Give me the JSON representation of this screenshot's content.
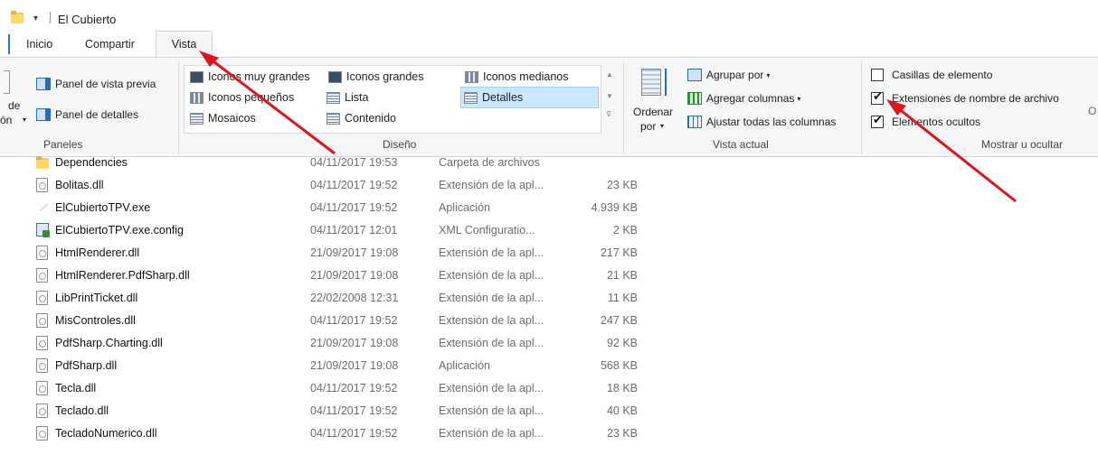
{
  "window": {
    "title": "El Cubierto",
    "quick_access_arrow": "▾"
  },
  "tabs": [
    {
      "label": "Inicio"
    },
    {
      "label": "Compartir"
    },
    {
      "label": "Vista"
    }
  ],
  "ribbon": {
    "panes": {
      "cut_label_1": "de",
      "cut_label_2": "ón",
      "preview_pane": "Panel de vista previa",
      "details_pane": "Panel de detalles",
      "group_label": "Paneles"
    },
    "layout": {
      "items": [
        "Iconos muy grandes",
        "Iconos grandes",
        "Iconos medianos",
        "Iconos pequeños",
        "Lista",
        "Detalles",
        "Mosaicos",
        "Contenido"
      ],
      "selected": "Detalles",
      "group_label": "Diseño"
    },
    "current_view": {
      "sort_by_1": "Ordenar",
      "sort_by_2": "por",
      "group_by": "Agrupar por",
      "add_columns": "Agregar columnas",
      "fit_columns": "Ajustar todas las columnas",
      "group_label": "Vista actual"
    },
    "show_hide": {
      "item_checkboxes": {
        "label": "Casillas de elemento",
        "checked": false
      },
      "file_extensions": {
        "label": "Extensiones de nombre de archivo",
        "checked": true
      },
      "hidden_items": {
        "label": "Elementos ocultos",
        "checked": true
      },
      "cut_label": "O",
      "group_label": "Mostrar u ocultar"
    }
  },
  "files": [
    {
      "name": "Dependencies",
      "date": "04/11/2017 19:53",
      "type": "Carpeta de archivos",
      "size": "",
      "icon": "folder-icon"
    },
    {
      "name": "Bolitas.dll",
      "date": "04/11/2017 19:52",
      "type": "Extensión de la apl...",
      "size": "23 KB",
      "icon": "dll-file-icon"
    },
    {
      "name": "ElCubiertoTPV.exe",
      "date": "04/11/2017 19:52",
      "type": "Aplicación",
      "size": "4.939 KB",
      "icon": "exe-file-icon"
    },
    {
      "name": "ElCubiertoTPV.exe.config",
      "date": "04/11/2017 12:01",
      "type": "XML Configuratio...",
      "size": "2 KB",
      "icon": "config-file-icon"
    },
    {
      "name": "HtmlRenderer.dll",
      "date": "21/09/2017 19:08",
      "type": "Extensión de la apl...",
      "size": "217 KB",
      "icon": "dll-file-icon"
    },
    {
      "name": "HtmlRenderer.PdfSharp.dll",
      "date": "21/09/2017 19:08",
      "type": "Extensión de la apl...",
      "size": "21 KB",
      "icon": "dll-file-icon"
    },
    {
      "name": "LibPrintTicket.dll",
      "date": "22/02/2008 12:31",
      "type": "Extensión de la apl...",
      "size": "11 KB",
      "icon": "dll-file-icon"
    },
    {
      "name": "MisControles.dll",
      "date": "04/11/2017 19:52",
      "type": "Extensión de la apl...",
      "size": "247 KB",
      "icon": "dll-file-icon"
    },
    {
      "name": "PdfSharp.Charting.dll",
      "date": "21/09/2017 19:08",
      "type": "Extensión de la apl...",
      "size": "92 KB",
      "icon": "dll-file-icon"
    },
    {
      "name": "PdfSharp.dll",
      "date": "21/09/2017 19:08",
      "type": "Aplicación",
      "size": "568 KB",
      "icon": "dll-file-icon"
    },
    {
      "name": "Tecla.dll",
      "date": "04/11/2017 19:52",
      "type": "Extensión de la apl...",
      "size": "18 KB",
      "icon": "dll-file-icon"
    },
    {
      "name": "Teclado.dll",
      "date": "04/11/2017 19:52",
      "type": "Extensión de la apl...",
      "size": "40 KB",
      "icon": "dll-file-icon"
    },
    {
      "name": "TecladoNumerico.dll",
      "date": "04/11/2017 19:52",
      "type": "Extensión de la apl...",
      "size": "23 KB",
      "icon": "dll-file-icon"
    }
  ],
  "annotation_color": "#e0141e"
}
